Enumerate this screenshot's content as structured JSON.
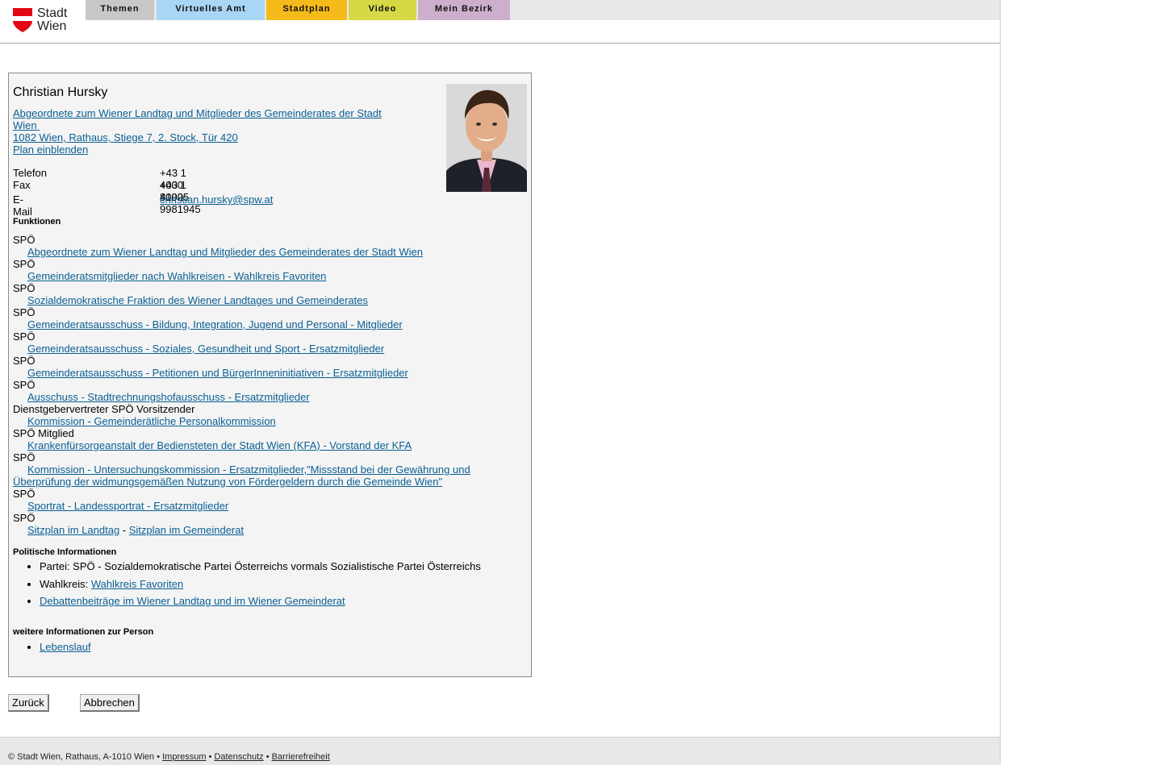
{
  "logo": {
    "line1": "Stadt",
    "line2": "Wien"
  },
  "nav": [
    {
      "label": "Themen",
      "color": "#c8c8c8"
    },
    {
      "label": "Virtuelles Amt",
      "color": "#a9d6f5"
    },
    {
      "label": "Stadtplan",
      "color": "#f5bb1b"
    },
    {
      "label": "Video",
      "color": "#d6d846"
    },
    {
      "label": "Mein Bezirk",
      "color": "#cdaecb"
    }
  ],
  "person": {
    "name": "Christian Hursky",
    "role_link_line1": "Abgeordnete zum Wiener Landtag und Mitglieder des Gemeinderates der Stadt",
    "role_link_line2": "Wien",
    "address": "1082 Wien, Rathaus, Stiege 7, 2. Stock, Tür 420",
    "map_link": "Plan einblenden"
  },
  "contact": {
    "phone_label": "Telefon",
    "phone": "+43 1 4000 81925",
    "fax_label": "Fax",
    "fax": "+43 1 4000 9981945",
    "email_label": "E-Mail",
    "email": "christian.hursky@spw.at"
  },
  "functions_heading": "Funktionen",
  "functions": [
    {
      "role": "SPÖ",
      "link": "Abgeordnete zum Wiener Landtag und Mitglieder des Gemeinderates der Stadt Wien"
    },
    {
      "role": "SPÖ",
      "link": "Gemeinderatsmitglieder nach Wahlkreisen - Wahlkreis Favoriten"
    },
    {
      "role": "SPÖ",
      "link": "Sozialdemokratische Fraktion des Wiener Landtages und Gemeinderates"
    },
    {
      "role": "SPÖ",
      "link": "Gemeinderatsausschuss - Bildung, Integration, Jugend und Personal - Mitglieder"
    },
    {
      "role": "SPÖ",
      "link": "Gemeinderatsausschuss - Soziales, Gesundheit und Sport - Ersatzmitglieder"
    },
    {
      "role": "SPÖ",
      "link": "Gemeinderatsausschuss - Petitionen und BürgerInneninitiativen - Ersatzmitglieder"
    },
    {
      "role": "SPÖ",
      "link": "Ausschuss - Stadtrechnungshofausschuss - Ersatzmitglieder"
    },
    {
      "role": "Dienstgebervertreter SPÖ Vorsitzender",
      "link": "Kommission - Gemeinderätliche Personalkommission"
    },
    {
      "role": "SPÖ Mitglied",
      "link": "Krankenfürsorgeanstalt der Bediensteten der Stadt Wien (KFA) - Vorstand der KFA"
    },
    {
      "role": "SPÖ",
      "link": "Kommission - Untersuchungskommission - Ersatzmitglieder,\"Missstand bei der Gewährung und Überprüfung der widmungsgemäßen Nutzung von Fördergeldern durch die Gemeinde Wien\""
    },
    {
      "role": "SPÖ",
      "link": "Sportrat - Landessportrat - Ersatzmitglieder"
    }
  ],
  "seating": {
    "role": "SPÖ",
    "link1": "Sitzplan im Landtag",
    "sep": " - ",
    "link2": "Sitzplan im Gemeinderat"
  },
  "political_heading": "Politische Informationen",
  "political": {
    "party": "Partei: SPÖ - Sozialdemokratische Partei Österreichs vormals Sozialistische Partei Österreichs",
    "district_label": "Wahlkreis: ",
    "district_link": "Wahlkreis Favoriten",
    "debate_link": "Debattenbeiträge im Wiener Landtag und im Wiener Gemeinderat"
  },
  "more_heading": "weitere Informationen zur Person",
  "more_link": "Lebenslauf",
  "buttons": {
    "back": "Zurück",
    "cancel": "Abbrechen"
  },
  "footer": {
    "copyright": "© Stadt Wien, Rathaus, A-1010 Wien",
    "sep": " • ",
    "impressum": "Impressum",
    "datenschutz": "Datenschutz",
    "barrierefreiheit": "Barrierefreiheit"
  }
}
